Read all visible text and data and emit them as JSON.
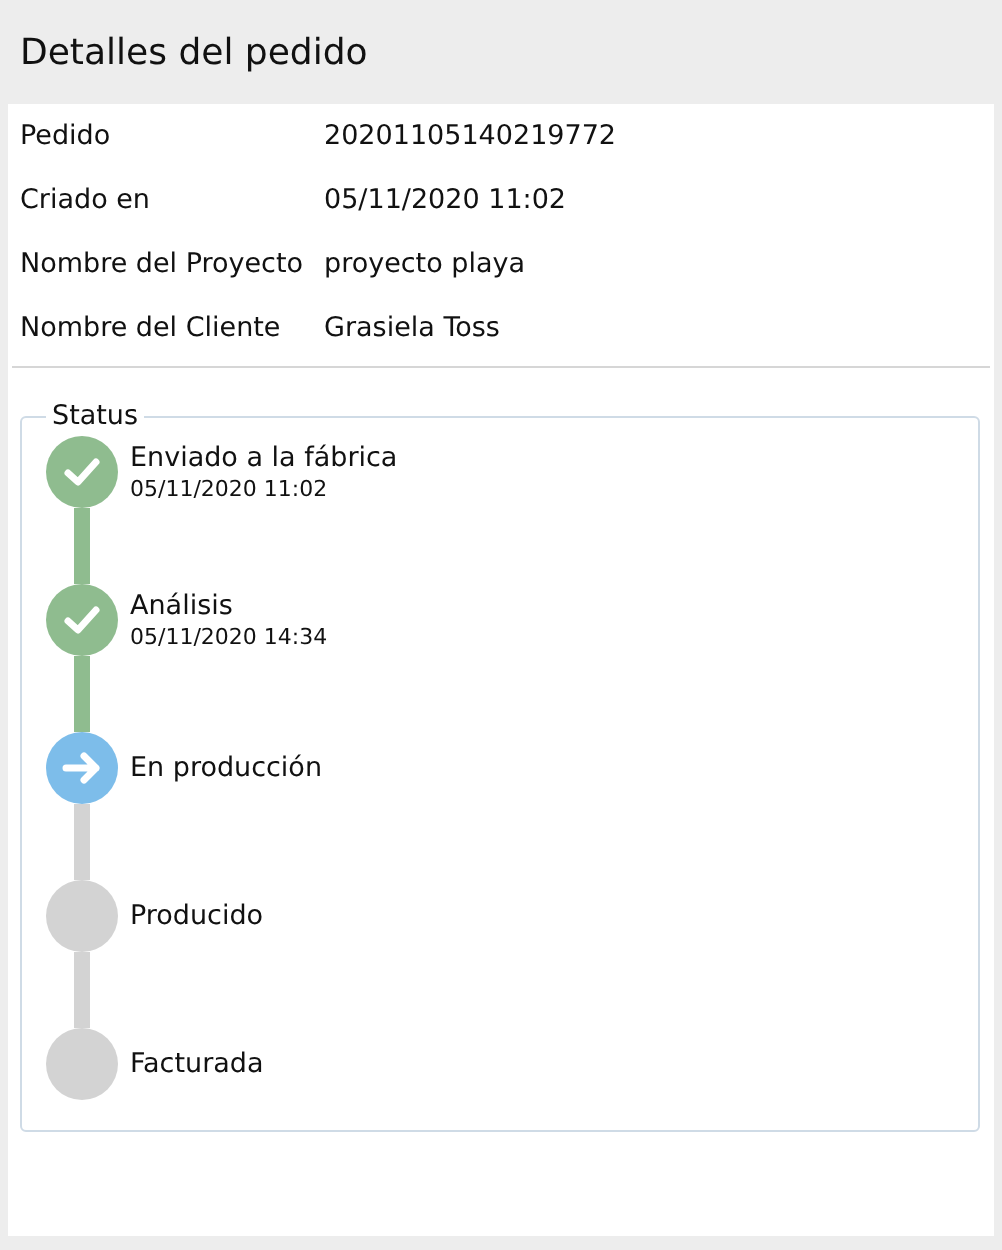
{
  "title": "Detalles del pedido",
  "details": [
    {
      "label": "Pedido",
      "value": "20201105140219772"
    },
    {
      "label": "Criado en",
      "value": "05/11/2020 11:02"
    },
    {
      "label": "Nombre del Proyecto",
      "value": "proyecto playa"
    },
    {
      "label": "Nombre del Cliente",
      "value": "Grasiela Toss"
    }
  ],
  "status": {
    "legend": "Status",
    "steps": [
      {
        "label": "Enviado a la fábrica",
        "date": "05/11/2020 11:02",
        "kind": "done"
      },
      {
        "label": "Análisis",
        "date": "05/11/2020 14:34",
        "kind": "done"
      },
      {
        "label": "En producción",
        "kind": "current"
      },
      {
        "label": "Producido",
        "kind": "pending"
      },
      {
        "label": "Facturada",
        "kind": "pending"
      }
    ]
  }
}
